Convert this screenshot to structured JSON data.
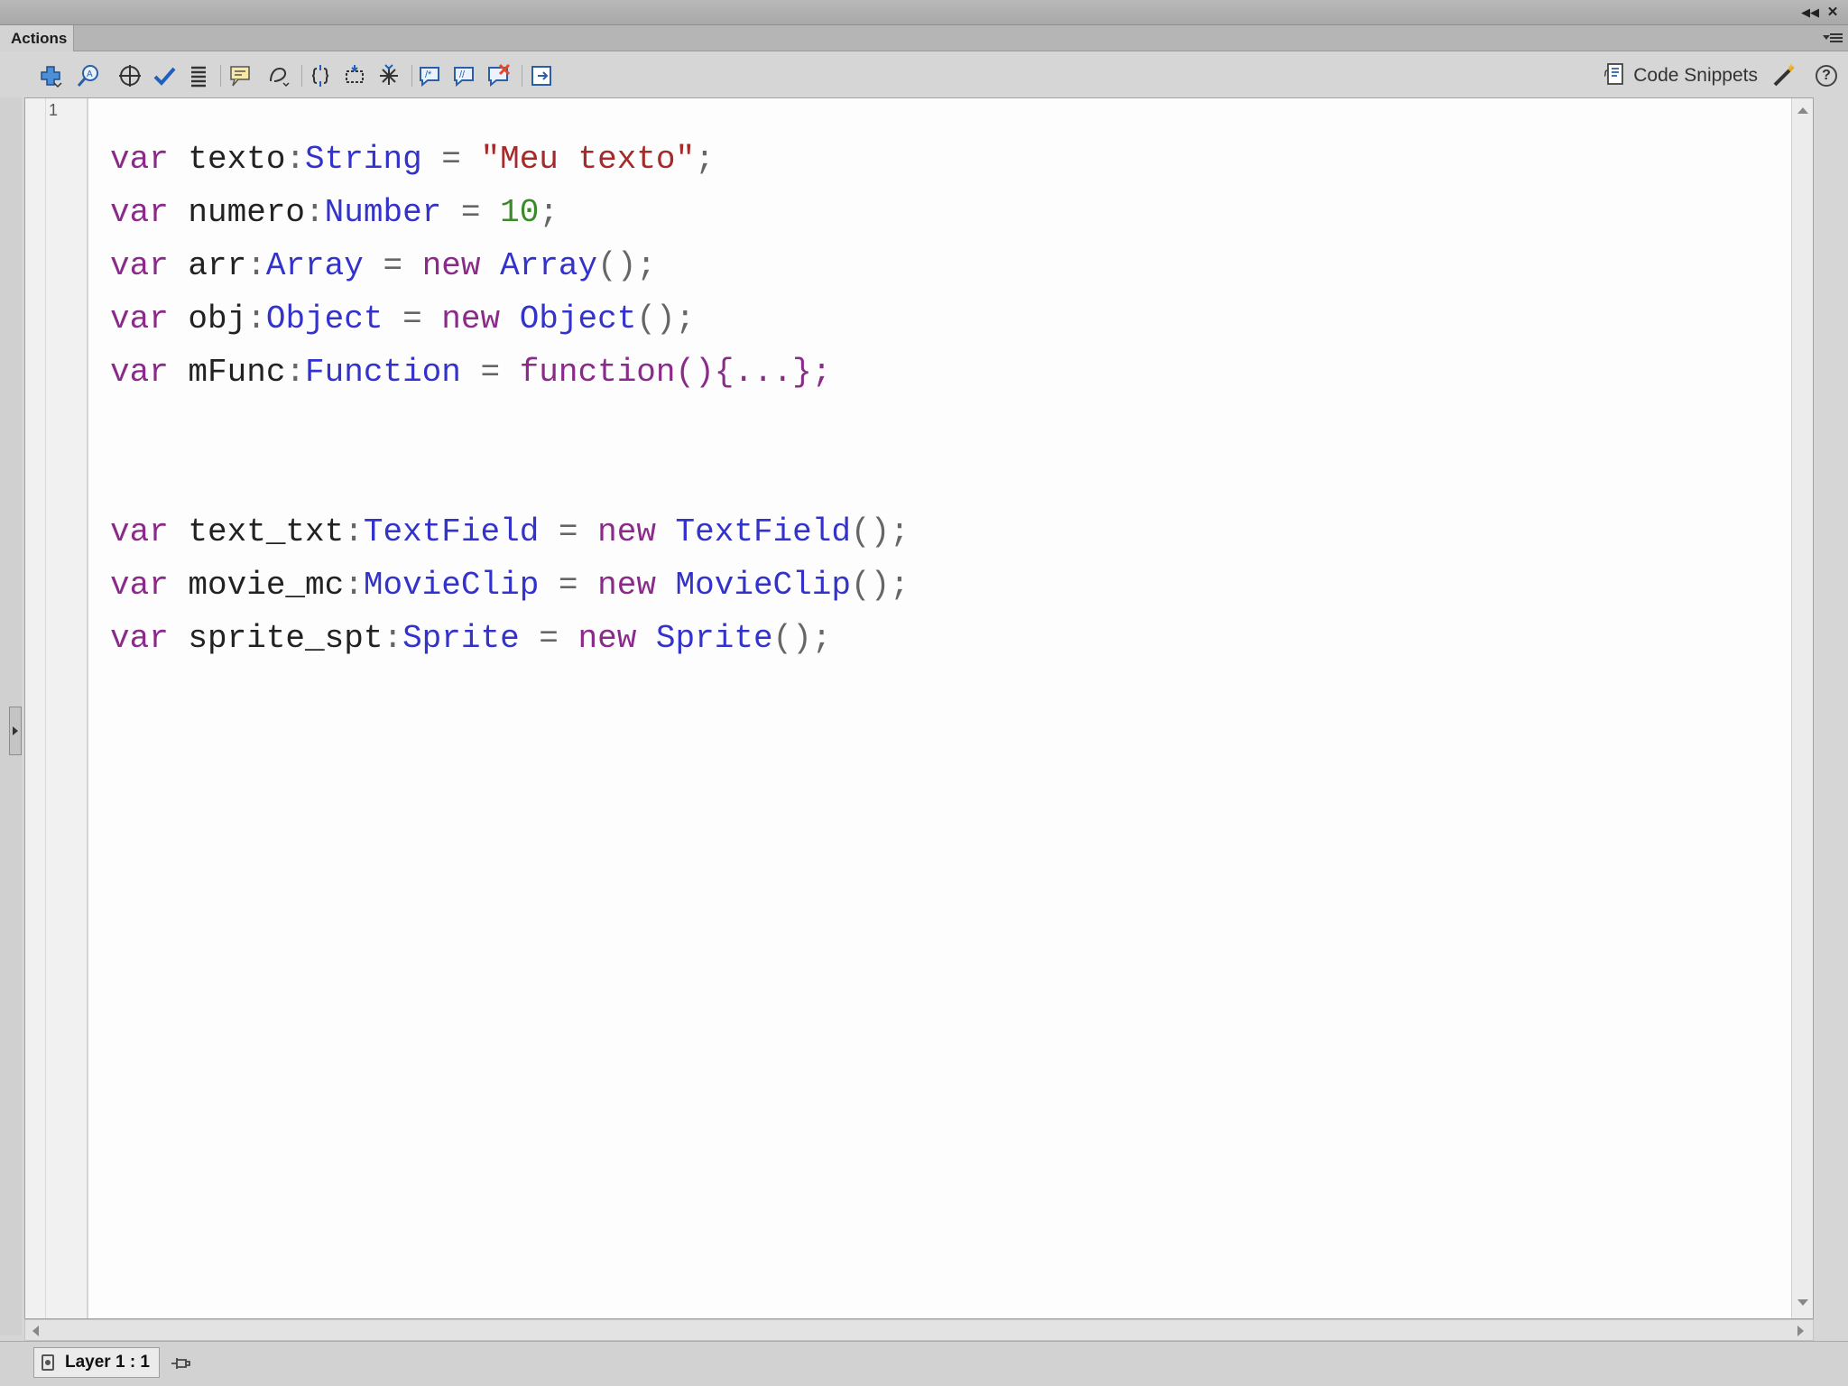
{
  "panel": {
    "tab_label": "Actions"
  },
  "toolbar": {
    "buttons": [
      {
        "name": "add-new-item-icon"
      },
      {
        "name": "find-icon"
      },
      {
        "name": "insert-target-path-icon"
      },
      {
        "name": "check-syntax-icon"
      },
      {
        "name": "auto-format-icon"
      },
      {
        "name": "show-code-hint-icon"
      },
      {
        "name": "debug-options-icon"
      },
      {
        "name": "collapse-between-braces-icon"
      },
      {
        "name": "collapse-selection-icon"
      },
      {
        "name": "expand-all-icon"
      },
      {
        "name": "apply-block-comment-icon"
      },
      {
        "name": "apply-line-comment-icon"
      },
      {
        "name": "remove-comment-icon"
      },
      {
        "name": "show-hide-toolbox-icon"
      }
    ],
    "code_snippets_label": "Code Snippets",
    "help_label": "?"
  },
  "editor": {
    "line_number": "1",
    "lines": [
      [
        {
          "t": "var",
          "c": "kw"
        },
        {
          "t": " texto",
          "c": ""
        },
        {
          "t": ":",
          "c": "pu"
        },
        {
          "t": "String",
          "c": "tp"
        },
        {
          "t": " = ",
          "c": "pu"
        },
        {
          "t": "\"Meu texto\"",
          "c": "st"
        },
        {
          "t": ";",
          "c": "pu"
        }
      ],
      [
        {
          "t": "var",
          "c": "kw"
        },
        {
          "t": " numero",
          "c": ""
        },
        {
          "t": ":",
          "c": "pu"
        },
        {
          "t": "Number",
          "c": "tp"
        },
        {
          "t": " = ",
          "c": "pu"
        },
        {
          "t": "10",
          "c": "nm"
        },
        {
          "t": ";",
          "c": "pu"
        }
      ],
      [
        {
          "t": "var",
          "c": "kw"
        },
        {
          "t": " arr",
          "c": ""
        },
        {
          "t": ":",
          "c": "pu"
        },
        {
          "t": "Array",
          "c": "tp"
        },
        {
          "t": " = ",
          "c": "pu"
        },
        {
          "t": "new",
          "c": "kw"
        },
        {
          "t": " ",
          "c": ""
        },
        {
          "t": "Array",
          "c": "tp"
        },
        {
          "t": "();",
          "c": "pu"
        }
      ],
      [
        {
          "t": "var",
          "c": "kw"
        },
        {
          "t": " obj",
          "c": ""
        },
        {
          "t": ":",
          "c": "pu"
        },
        {
          "t": "Object",
          "c": "tp"
        },
        {
          "t": " = ",
          "c": "pu"
        },
        {
          "t": "new",
          "c": "kw"
        },
        {
          "t": " ",
          "c": ""
        },
        {
          "t": "Object",
          "c": "tp"
        },
        {
          "t": "();",
          "c": "pu"
        }
      ],
      [
        {
          "t": "var",
          "c": "kw"
        },
        {
          "t": " mFunc",
          "c": ""
        },
        {
          "t": ":",
          "c": "pu"
        },
        {
          "t": "Function",
          "c": "tp"
        },
        {
          "t": " = ",
          "c": "pu"
        },
        {
          "t": "function(){...};",
          "c": "kw"
        }
      ],
      [],
      [],
      [
        {
          "t": "var",
          "c": "kw"
        },
        {
          "t": " text_txt",
          "c": ""
        },
        {
          "t": ":",
          "c": "pu"
        },
        {
          "t": "TextField",
          "c": "tp"
        },
        {
          "t": " = ",
          "c": "pu"
        },
        {
          "t": "new",
          "c": "kw"
        },
        {
          "t": " ",
          "c": ""
        },
        {
          "t": "TextField",
          "c": "tp"
        },
        {
          "t": "();",
          "c": "pu"
        }
      ],
      [
        {
          "t": "var",
          "c": "kw"
        },
        {
          "t": " movie_mc",
          "c": ""
        },
        {
          "t": ":",
          "c": "pu"
        },
        {
          "t": "MovieClip",
          "c": "tp"
        },
        {
          "t": " = ",
          "c": "pu"
        },
        {
          "t": "new",
          "c": "kw"
        },
        {
          "t": " ",
          "c": ""
        },
        {
          "t": "MovieClip",
          "c": "tp"
        },
        {
          "t": "();",
          "c": "pu"
        }
      ],
      [
        {
          "t": "var",
          "c": "kw"
        },
        {
          "t": " sprite_spt",
          "c": ""
        },
        {
          "t": ":",
          "c": "pu"
        },
        {
          "t": "Sprite",
          "c": "tp"
        },
        {
          "t": " = ",
          "c": "pu"
        },
        {
          "t": "new",
          "c": "kw"
        },
        {
          "t": " ",
          "c": ""
        },
        {
          "t": "Sprite",
          "c": "tp"
        },
        {
          "t": "();",
          "c": "pu"
        }
      ]
    ]
  },
  "status": {
    "layer_label": "Layer 1 : 1"
  },
  "colors": {
    "keyword": "#8a2b8a",
    "type": "#3333cc",
    "string": "#a52a2a",
    "number": "#3a8a2a"
  }
}
